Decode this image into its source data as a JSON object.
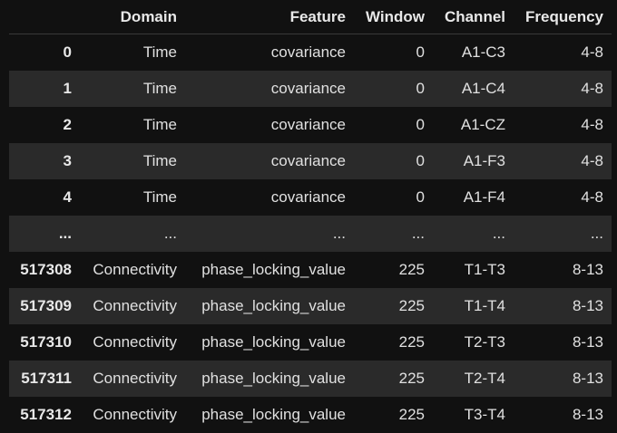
{
  "table": {
    "columns": [
      "",
      "Domain",
      "Feature",
      "Window",
      "Channel",
      "Frequency"
    ],
    "rows": [
      {
        "index": "0",
        "domain": "Time",
        "feature": "covariance",
        "window": "0",
        "channel": "A1-C3",
        "frequency": "4-8"
      },
      {
        "index": "1",
        "domain": "Time",
        "feature": "covariance",
        "window": "0",
        "channel": "A1-C4",
        "frequency": "4-8"
      },
      {
        "index": "2",
        "domain": "Time",
        "feature": "covariance",
        "window": "0",
        "channel": "A1-CZ",
        "frequency": "4-8"
      },
      {
        "index": "3",
        "domain": "Time",
        "feature": "covariance",
        "window": "0",
        "channel": "A1-F3",
        "frequency": "4-8"
      },
      {
        "index": "4",
        "domain": "Time",
        "feature": "covariance",
        "window": "0",
        "channel": "A1-F4",
        "frequency": "4-8"
      },
      {
        "index": "...",
        "domain": "...",
        "feature": "...",
        "window": "...",
        "channel": "...",
        "frequency": "..."
      },
      {
        "index": "517308",
        "domain": "Connectivity",
        "feature": "phase_locking_value",
        "window": "225",
        "channel": "T1-T3",
        "frequency": "8-13"
      },
      {
        "index": "517309",
        "domain": "Connectivity",
        "feature": "phase_locking_value",
        "window": "225",
        "channel": "T1-T4",
        "frequency": "8-13"
      },
      {
        "index": "517310",
        "domain": "Connectivity",
        "feature": "phase_locking_value",
        "window": "225",
        "channel": "T2-T3",
        "frequency": "8-13"
      },
      {
        "index": "517311",
        "domain": "Connectivity",
        "feature": "phase_locking_value",
        "window": "225",
        "channel": "T2-T4",
        "frequency": "8-13"
      },
      {
        "index": "517312",
        "domain": "Connectivity",
        "feature": "phase_locking_value",
        "window": "225",
        "channel": "T3-T4",
        "frequency": "8-13"
      }
    ]
  },
  "colors": {
    "background": "#111111",
    "row_stripe": "#2a2a2a",
    "text": "#e6e6e6",
    "header_border": "#3a3a3a"
  }
}
